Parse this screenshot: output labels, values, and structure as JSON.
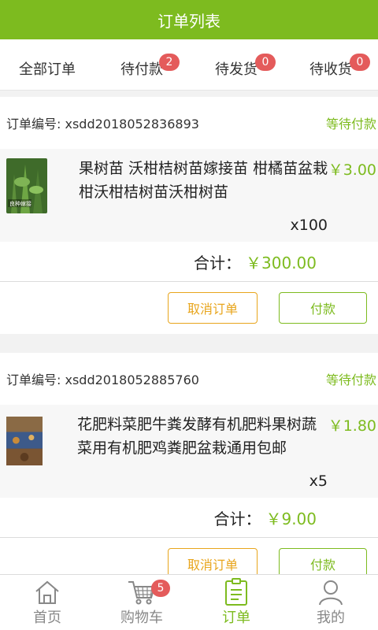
{
  "header": {
    "title": "订单列表"
  },
  "tabs": [
    {
      "label": "全部订单",
      "badge": null
    },
    {
      "label": "待付款",
      "badge": "2"
    },
    {
      "label": "待发货",
      "badge": "0"
    },
    {
      "label": "待收货",
      "badge": "0"
    }
  ],
  "orders": [
    {
      "number_label": "订单编号: xsdd2018052836893",
      "status": "等待付款",
      "product_name": "果树苗 沃柑桔树苗嫁接苗 柑橘苗盆栽柑沃柑桔树苗沃柑树苗",
      "price": "￥3.00",
      "qty": "x100",
      "total_label": "合计：",
      "total": "￥300.00",
      "cancel_label": "取消订单",
      "pay_label": "付款",
      "thumb_text": "良种嫁接"
    },
    {
      "number_label": "订单编号: xsdd2018052885760",
      "status": "等待付款",
      "product_name": "花肥料菜肥牛粪发酵有机肥料果树蔬菜用有机肥鸡粪肥盆栽通用包邮",
      "price": "￥1.80",
      "qty": "x5",
      "total_label": "合计：",
      "total": "￥9.00",
      "cancel_label": "取消订单",
      "pay_label": "付款"
    }
  ],
  "nav": [
    {
      "label": "首页",
      "icon": "home-icon"
    },
    {
      "label": "购物车",
      "icon": "cart-icon",
      "badge": "5"
    },
    {
      "label": "订单",
      "icon": "order-icon"
    },
    {
      "label": "我的",
      "icon": "user-icon"
    }
  ],
  "colors": {
    "brand": "#7dbb1f",
    "badge": "#e45b5b",
    "cancel": "#e8a51c"
  }
}
